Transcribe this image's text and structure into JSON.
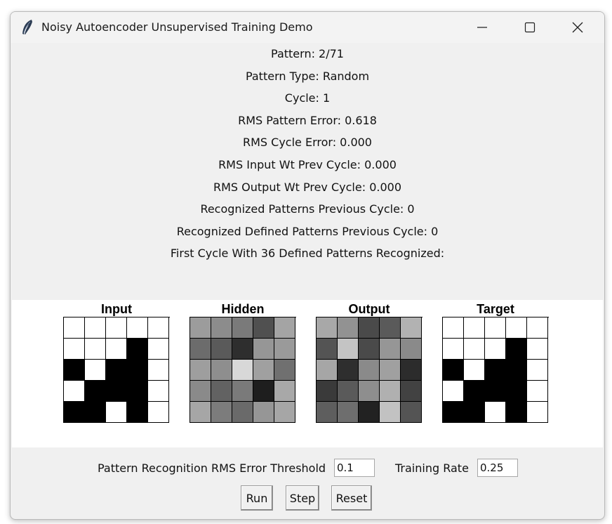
{
  "window": {
    "title": "Noisy Autoencoder Unsupervised Training Demo",
    "minimize_glyph": "—",
    "maximize_glyph": "☐",
    "close_glyph": "✕"
  },
  "info": {
    "pattern": "Pattern: 2/71",
    "pattern_type": "Pattern Type: Random",
    "cycle": "Cycle: 1",
    "rms_pattern_error": "RMS Pattern Error: 0.618",
    "rms_cycle_error": "RMS Cycle Error: 0.000",
    "rms_input_wt": "RMS Input Wt Prev Cycle: 0.000",
    "rms_output_wt": "RMS Output Wt Prev Cycle: 0.000",
    "recognized_patterns": "Recognized Patterns Previous Cycle: 0",
    "recognized_defined": "Recognized Defined Patterns Previous Cycle: 0",
    "first_cycle": "First Cycle With 36 Defined Patterns Recognized:"
  },
  "grids": [
    {
      "title": "Input",
      "cells": [
        [
          "#ffffff",
          "#ffffff",
          "#ffffff",
          "#ffffff",
          "#ffffff"
        ],
        [
          "#ffffff",
          "#ffffff",
          "#ffffff",
          "#000000",
          "#ffffff"
        ],
        [
          "#000000",
          "#ffffff",
          "#000000",
          "#000000",
          "#ffffff"
        ],
        [
          "#ffffff",
          "#000000",
          "#000000",
          "#000000",
          "#ffffff"
        ],
        [
          "#000000",
          "#000000",
          "#ffffff",
          "#000000",
          "#ffffff"
        ]
      ]
    },
    {
      "title": "Hidden",
      "cells": [
        [
          "#9c9c9c",
          "#8c8c8c",
          "#7a7a7a",
          "#505050",
          "#a4a4a4"
        ],
        [
          "#6c6c6c",
          "#5a5a5a",
          "#2e2e2e",
          "#969696",
          "#9a9a9a"
        ],
        [
          "#9e9e9e",
          "#8e8e8e",
          "#d8d8d8",
          "#a0a0a0",
          "#707070"
        ],
        [
          "#8a8a8a",
          "#626262",
          "#7a7a7a",
          "#1e1e1e",
          "#a8a8a8"
        ],
        [
          "#a6a6a6",
          "#7c7c7c",
          "#6a6a6a",
          "#969696",
          "#a6a6a6"
        ]
      ]
    },
    {
      "title": "Output",
      "cells": [
        [
          "#a8a8a8",
          "#929292",
          "#4a4a4a",
          "#5a5a5a",
          "#b2b2b2"
        ],
        [
          "#545454",
          "#c4c4c4",
          "#4a4a4a",
          "#969696",
          "#8a8a8a"
        ],
        [
          "#a6a6a6",
          "#2e2e2e",
          "#8a8a8a",
          "#a0a0a0",
          "#2c2c2c"
        ],
        [
          "#3a3a3a",
          "#5a5a5a",
          "#8e8e8e",
          "#b0b0b0",
          "#424242"
        ],
        [
          "#5e5e5e",
          "#6e6e6e",
          "#222222",
          "#c2c2c2",
          "#545454"
        ]
      ]
    },
    {
      "title": "Target",
      "cells": [
        [
          "#ffffff",
          "#ffffff",
          "#ffffff",
          "#ffffff",
          "#ffffff"
        ],
        [
          "#ffffff",
          "#ffffff",
          "#ffffff",
          "#000000",
          "#ffffff"
        ],
        [
          "#000000",
          "#ffffff",
          "#000000",
          "#000000",
          "#ffffff"
        ],
        [
          "#ffffff",
          "#000000",
          "#000000",
          "#000000",
          "#ffffff"
        ],
        [
          "#000000",
          "#000000",
          "#ffffff",
          "#000000",
          "#ffffff"
        ]
      ]
    }
  ],
  "controls": {
    "threshold_label": "Pattern Recognition RMS Error Threshold",
    "threshold_value": "0.1",
    "rate_label": "Training Rate",
    "rate_value": "0.25"
  },
  "buttons": {
    "run": "Run",
    "step": "Step",
    "reset": "Reset"
  }
}
